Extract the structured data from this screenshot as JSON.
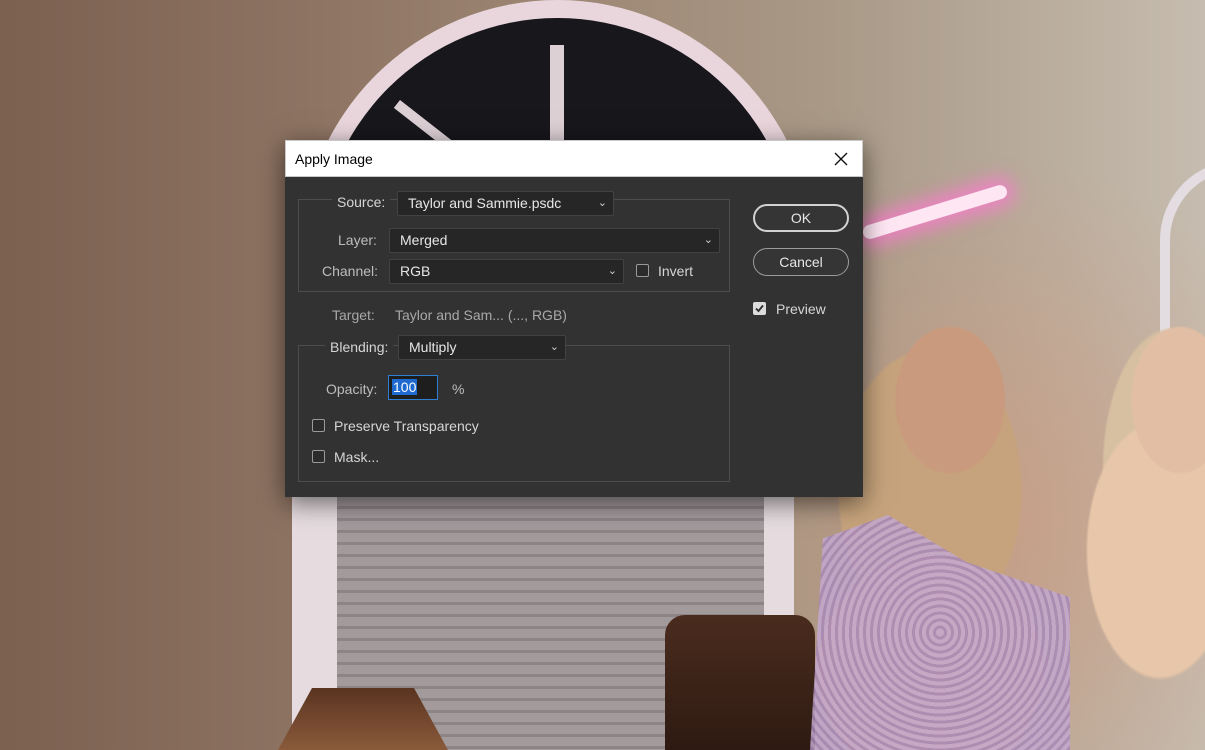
{
  "dialog": {
    "title": "Apply Image",
    "source": {
      "label": "Source:",
      "value": "Taylor and Sammie.psdc"
    },
    "layer": {
      "label": "Layer:",
      "value": "Merged"
    },
    "channel": {
      "label": "Channel:",
      "value": "RGB"
    },
    "invert": {
      "label": "Invert",
      "checked": false
    },
    "target": {
      "label": "Target:",
      "value": "Taylor and Sam... (..., RGB)"
    },
    "blending": {
      "label": "Blending:",
      "value": "Multiply"
    },
    "opacity": {
      "label": "Opacity:",
      "value": "100",
      "unit": "%"
    },
    "preserve_transparency": {
      "label": "Preserve Transparency",
      "checked": false
    },
    "mask": {
      "label": "Mask...",
      "checked": false
    },
    "buttons": {
      "ok": "OK",
      "cancel": "Cancel"
    },
    "preview": {
      "label": "Preview",
      "checked": true
    }
  },
  "icons": {
    "close": "close-icon",
    "dropdown": "chevron-down-icon",
    "check": "checkmark-icon"
  },
  "colors": {
    "dialog_bg": "#323232",
    "titlebar_bg": "#ffffff",
    "focus_blue": "#2c7fd3",
    "selection_blue": "#1f6ad0"
  }
}
